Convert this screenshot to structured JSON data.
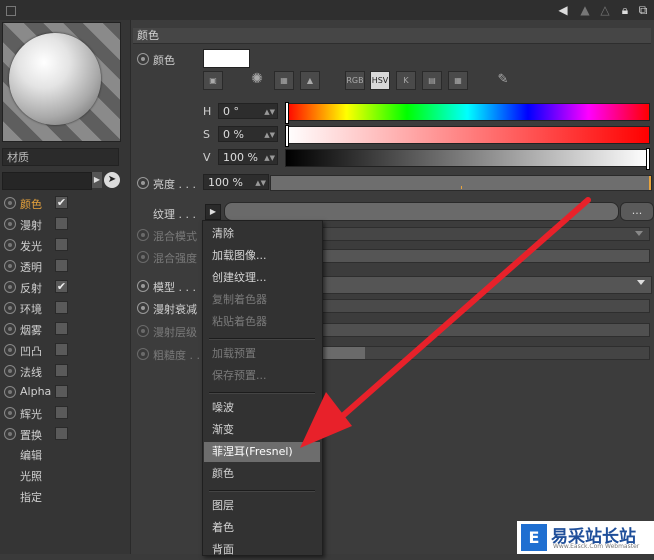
{
  "toolbar": {
    "icons": [
      "back-arrow-icon",
      "up-arrow-icon",
      "lock-icon",
      "new-window-icon"
    ]
  },
  "left_panel": {
    "material_label": "材质",
    "channels": [
      {
        "label": "颜色",
        "checked": true,
        "active": true
      },
      {
        "label": "漫射",
        "checked": false
      },
      {
        "label": "发光",
        "checked": false
      },
      {
        "label": "透明",
        "checked": false
      },
      {
        "label": "反射",
        "checked": true
      },
      {
        "label": "环境",
        "checked": false
      },
      {
        "label": "烟雾",
        "checked": false
      },
      {
        "label": "凹凸",
        "checked": false
      },
      {
        "label": "法线",
        "checked": false
      },
      {
        "label": "Alpha",
        "checked": false
      },
      {
        "label": "辉光",
        "checked": false
      },
      {
        "label": "置换",
        "checked": false
      }
    ],
    "extra_items": [
      "编辑",
      "光照",
      "指定"
    ]
  },
  "color_section": {
    "header": "颜色",
    "color_label": "颜色",
    "swatch_color": "#ffffff",
    "mode_icons": [
      "RGB",
      "HSV",
      "K"
    ],
    "h_label": "H",
    "h_value": "0 °",
    "s_label": "S",
    "s_value": "0 %",
    "v_label": "V",
    "v_value": "100 %",
    "brightness_label": "亮度 . . .",
    "brightness_value": "100 %",
    "brightness_fraction": 1.0,
    "texture_label": "纹理 . . .",
    "texture_more": "...",
    "blend_mode_label": "混合模式",
    "blend_strength_label": "混合强度",
    "model_label": "模型 . . .",
    "diffuse_falloff_label": "漫射衰减",
    "diffuse_level_label": "漫射层级",
    "roughness_label": "粗糙度 . . ."
  },
  "context_menu": {
    "items": [
      {
        "label": "清除",
        "enabled": true
      },
      {
        "label": "加载图像...",
        "enabled": true
      },
      {
        "label": "创建纹理...",
        "enabled": true
      },
      {
        "label": "复制着色器",
        "enabled": false
      },
      {
        "label": "粘贴着色器",
        "enabled": false
      },
      {
        "separator": true
      },
      {
        "label": "加载预置",
        "enabled": false
      },
      {
        "label": "保存预置...",
        "enabled": false
      },
      {
        "separator": true
      },
      {
        "label": "噪波",
        "enabled": true
      },
      {
        "label": "渐变",
        "enabled": true
      },
      {
        "label": "菲涅耳(Fresnel)",
        "enabled": true,
        "highlighted": true
      },
      {
        "label": "颜色",
        "enabled": true
      },
      {
        "separator": true
      },
      {
        "label": "图层",
        "enabled": true
      },
      {
        "label": "着色",
        "enabled": true
      },
      {
        "label": "背面",
        "enabled": true
      }
    ]
  },
  "watermark": {
    "text": "易采站长站",
    "sub": "Www.Easck.Com Webmaster",
    "logo_glyph": "E"
  },
  "annotation": {
    "arrow_color": "#e8212a"
  }
}
